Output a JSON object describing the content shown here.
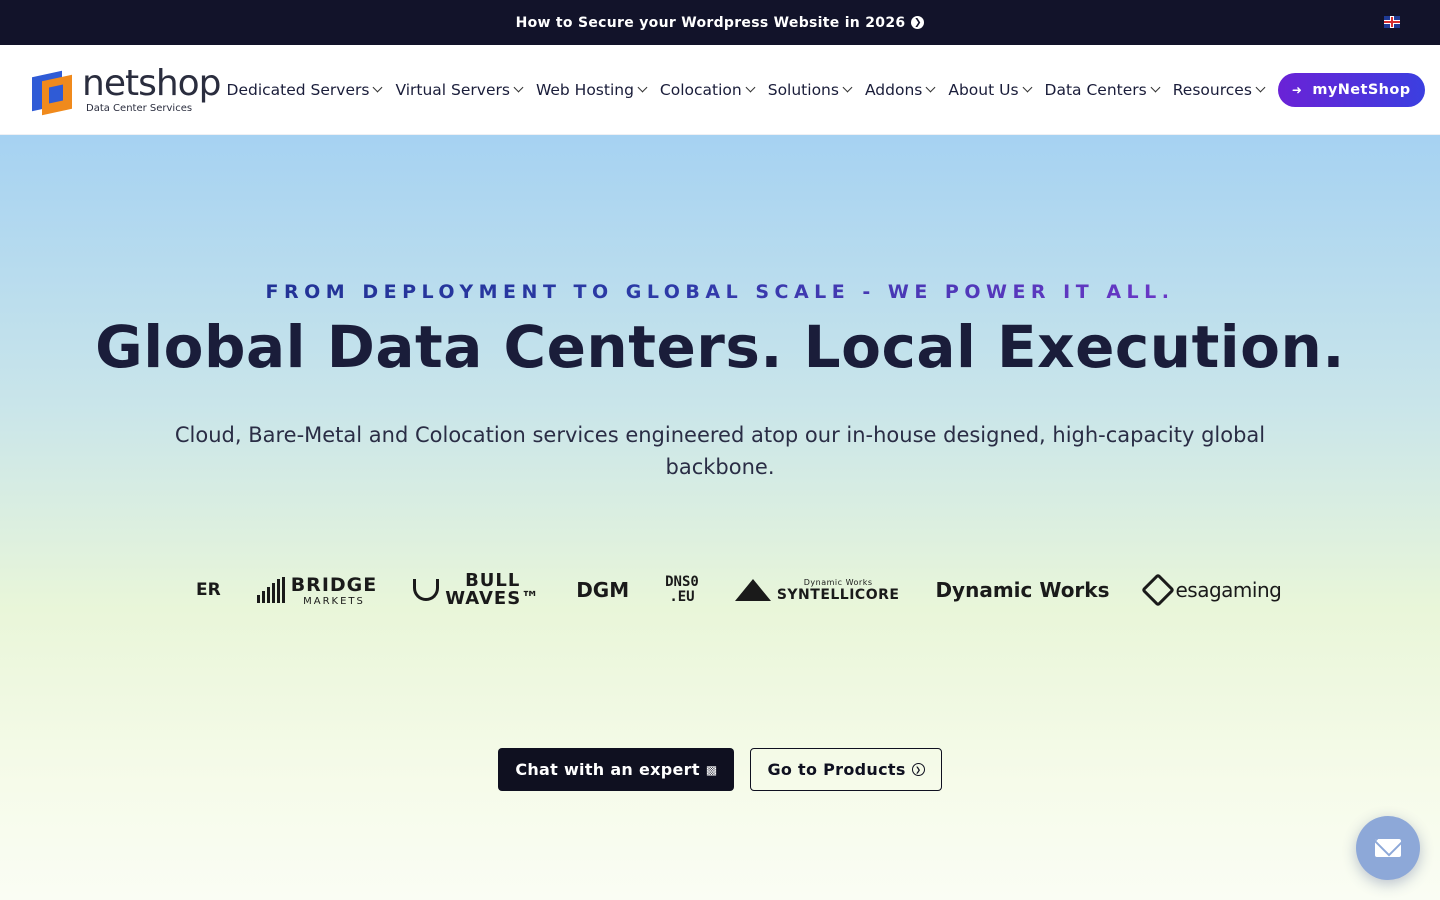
{
  "announcement": {
    "text": "How to Secure your Wordpress Website in 2026",
    "arrow_icon": "chevron-right-circle-icon"
  },
  "language": {
    "flag": "uk-flag-icon"
  },
  "brand": {
    "name": "netshop",
    "tagline": "Data Center Services"
  },
  "nav": {
    "items": [
      {
        "label": "Dedicated Servers"
      },
      {
        "label": "Virtual Servers"
      },
      {
        "label": "Web Hosting"
      },
      {
        "label": "Colocation"
      },
      {
        "label": "Solutions"
      },
      {
        "label": "Addons"
      },
      {
        "label": "About Us"
      },
      {
        "label": "Data Centers"
      },
      {
        "label": "Resources"
      }
    ],
    "account_button": "myNetShop"
  },
  "hero": {
    "eyebrow": "FROM DEPLOYMENT TO GLOBAL SCALE - WE POWER IT ALL.",
    "headline": "Global Data Centers. Local Execution.",
    "subhead": "Cloud, Bare-Metal and Colocation services engineered atop our in-house designed, high-capacity global backbone."
  },
  "client_logos": {
    "er": "ER",
    "bridge": "BRIDGE",
    "bridge_sub": "MARKETS",
    "bull_1": "BULL",
    "bull_2": "WAVES™",
    "dgm": "DGM",
    "dns_1": "DNS0",
    "dns_2": ".EU",
    "synt_small": "Dynamic Works",
    "synt": "SYNTELLICORE",
    "dynamic": "Dynamic Works",
    "esa": "esagaming"
  },
  "cta": {
    "primary": "Chat with an expert",
    "secondary": "Go to Products"
  },
  "colors": {
    "accent_purple": "#6a22d6",
    "accent_blue": "#3b3fe0",
    "dark": "#12132a",
    "logo_blue": "#2f5bd6",
    "logo_orange": "#f08a1c"
  }
}
